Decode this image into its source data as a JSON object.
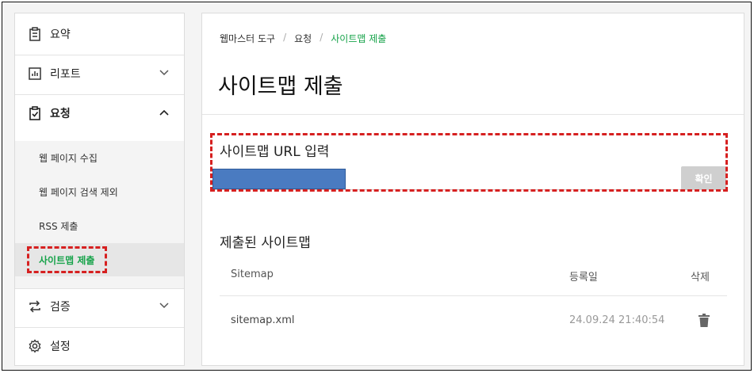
{
  "sidebar": {
    "items": [
      {
        "label": "요약",
        "icon": "clipboard-icon"
      },
      {
        "label": "리포트",
        "icon": "chart-icon"
      },
      {
        "label": "요청",
        "icon": "checklist-icon"
      },
      {
        "label": "검증",
        "icon": "repeat-icon"
      },
      {
        "label": "설정",
        "icon": "gear-icon"
      }
    ],
    "sub_items": [
      {
        "label": "웹 페이지 수집"
      },
      {
        "label": "웹 페이지 검색 제외"
      },
      {
        "label": "RSS 제출"
      },
      {
        "label": "사이트맵 제출"
      }
    ]
  },
  "breadcrumb": {
    "items": [
      "웹마스터 도구",
      "요청",
      "사이트맵 제출"
    ],
    "separator": "/"
  },
  "main": {
    "title": "사이트맵 제출",
    "input_label": "사이트맵 URL 입력",
    "url_value": "",
    "confirm_label": "확인",
    "section_title": "제출된 사이트맵",
    "table": {
      "headers": [
        "Sitemap",
        "등록일",
        "삭제"
      ],
      "rows": [
        {
          "sitemap": "sitemap.xml",
          "date": "24.09.24 21:40:54"
        }
      ]
    }
  },
  "colors": {
    "accent": "#17a34a",
    "highlight": "#d62020",
    "input_fill": "#4a7bc1"
  }
}
